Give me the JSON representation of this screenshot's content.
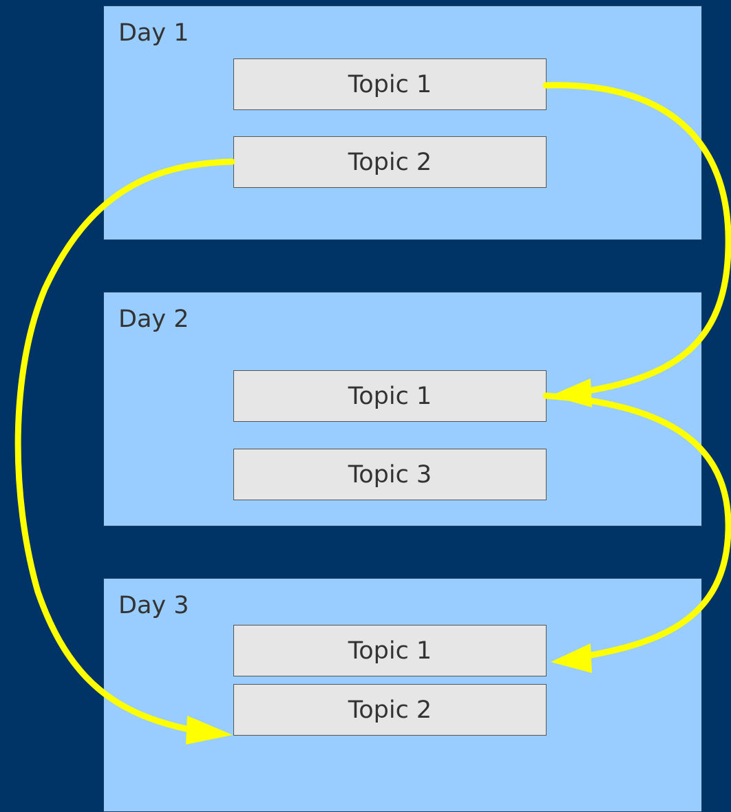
{
  "colors": {
    "background": "#003366",
    "day_panel": "#99ccff",
    "topic_box": "#e6e6e6",
    "arrow": "#ffff00",
    "text": "#333333"
  },
  "days": [
    {
      "label": "Day 1",
      "topics": [
        "Topic 1",
        "Topic 2"
      ]
    },
    {
      "label": "Day 2",
      "topics": [
        "Topic 1",
        "Topic 3"
      ]
    },
    {
      "label": "Day 3",
      "topics": [
        "Topic 1",
        "Topic 2"
      ]
    }
  ],
  "arrows": [
    {
      "from": "Day 1 Topic 1",
      "to": "Day 2 Topic 1",
      "icon": "curved-arrow"
    },
    {
      "from": "Day 2 Topic 1",
      "to": "Day 3 Topic 1",
      "icon": "curved-arrow"
    },
    {
      "from": "Day 1 Topic 2",
      "to": "Day 3 Topic 2",
      "icon": "curved-arrow"
    }
  ]
}
